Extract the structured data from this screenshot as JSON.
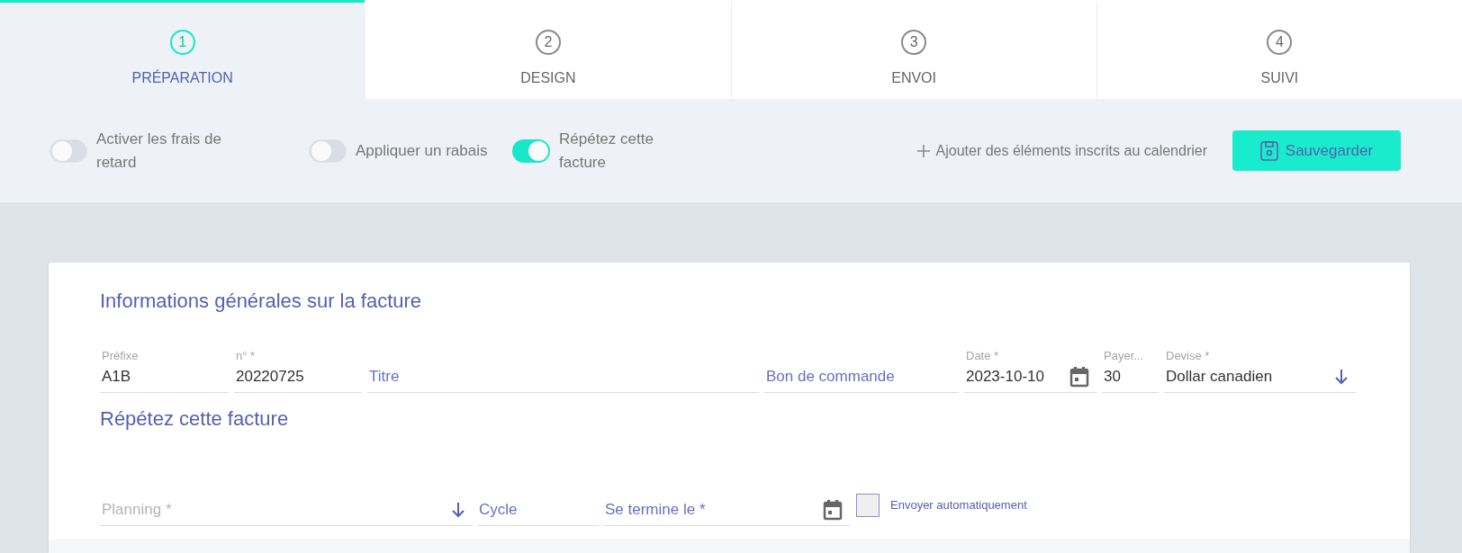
{
  "steps": [
    {
      "number": "1",
      "label": "PRÉPARATION",
      "selected": true
    },
    {
      "number": "2",
      "label": "DESIGN",
      "selected": false
    },
    {
      "number": "3",
      "label": "ENVOI",
      "selected": false
    },
    {
      "number": "4",
      "label": "SUIVI",
      "selected": false
    }
  ],
  "toolbar": {
    "toggles": [
      {
        "label": "Activer les frais de retard",
        "on": false
      },
      {
        "label": "Appliquer un rabais",
        "on": false
      },
      {
        "label": "Répétez cette facture",
        "on": true
      }
    ],
    "add_link": "Ajouter des éléments inscrits au calendrier",
    "save_button": "Sauvegarder"
  },
  "general": {
    "title": "Informations générales sur la facture",
    "fields": [
      {
        "kind": "text",
        "label": "Préfixe",
        "value": "A1B"
      },
      {
        "kind": "text",
        "label": "n° *",
        "value": "20220725"
      },
      {
        "kind": "text",
        "placeholder": "Titre"
      },
      {
        "kind": "text",
        "placeholder": "Bon de commande"
      },
      {
        "kind": "date",
        "label": "Date *",
        "value": "2023-10-10"
      },
      {
        "kind": "text",
        "label": "Payer...",
        "value": "30"
      },
      {
        "kind": "select",
        "label": "Devise *",
        "value": "Dollar canadien"
      }
    ]
  },
  "repeat": {
    "title": "Répétez cette facture",
    "fields": [
      {
        "kind": "select",
        "placeholder": "Planning *"
      },
      {
        "kind": "text",
        "placeholder": "Cycle"
      },
      {
        "kind": "date",
        "placeholder": "Se termine le *"
      }
    ],
    "auto_send": {
      "label": "Envoyer automatiquement",
      "checked": false
    }
  }
}
